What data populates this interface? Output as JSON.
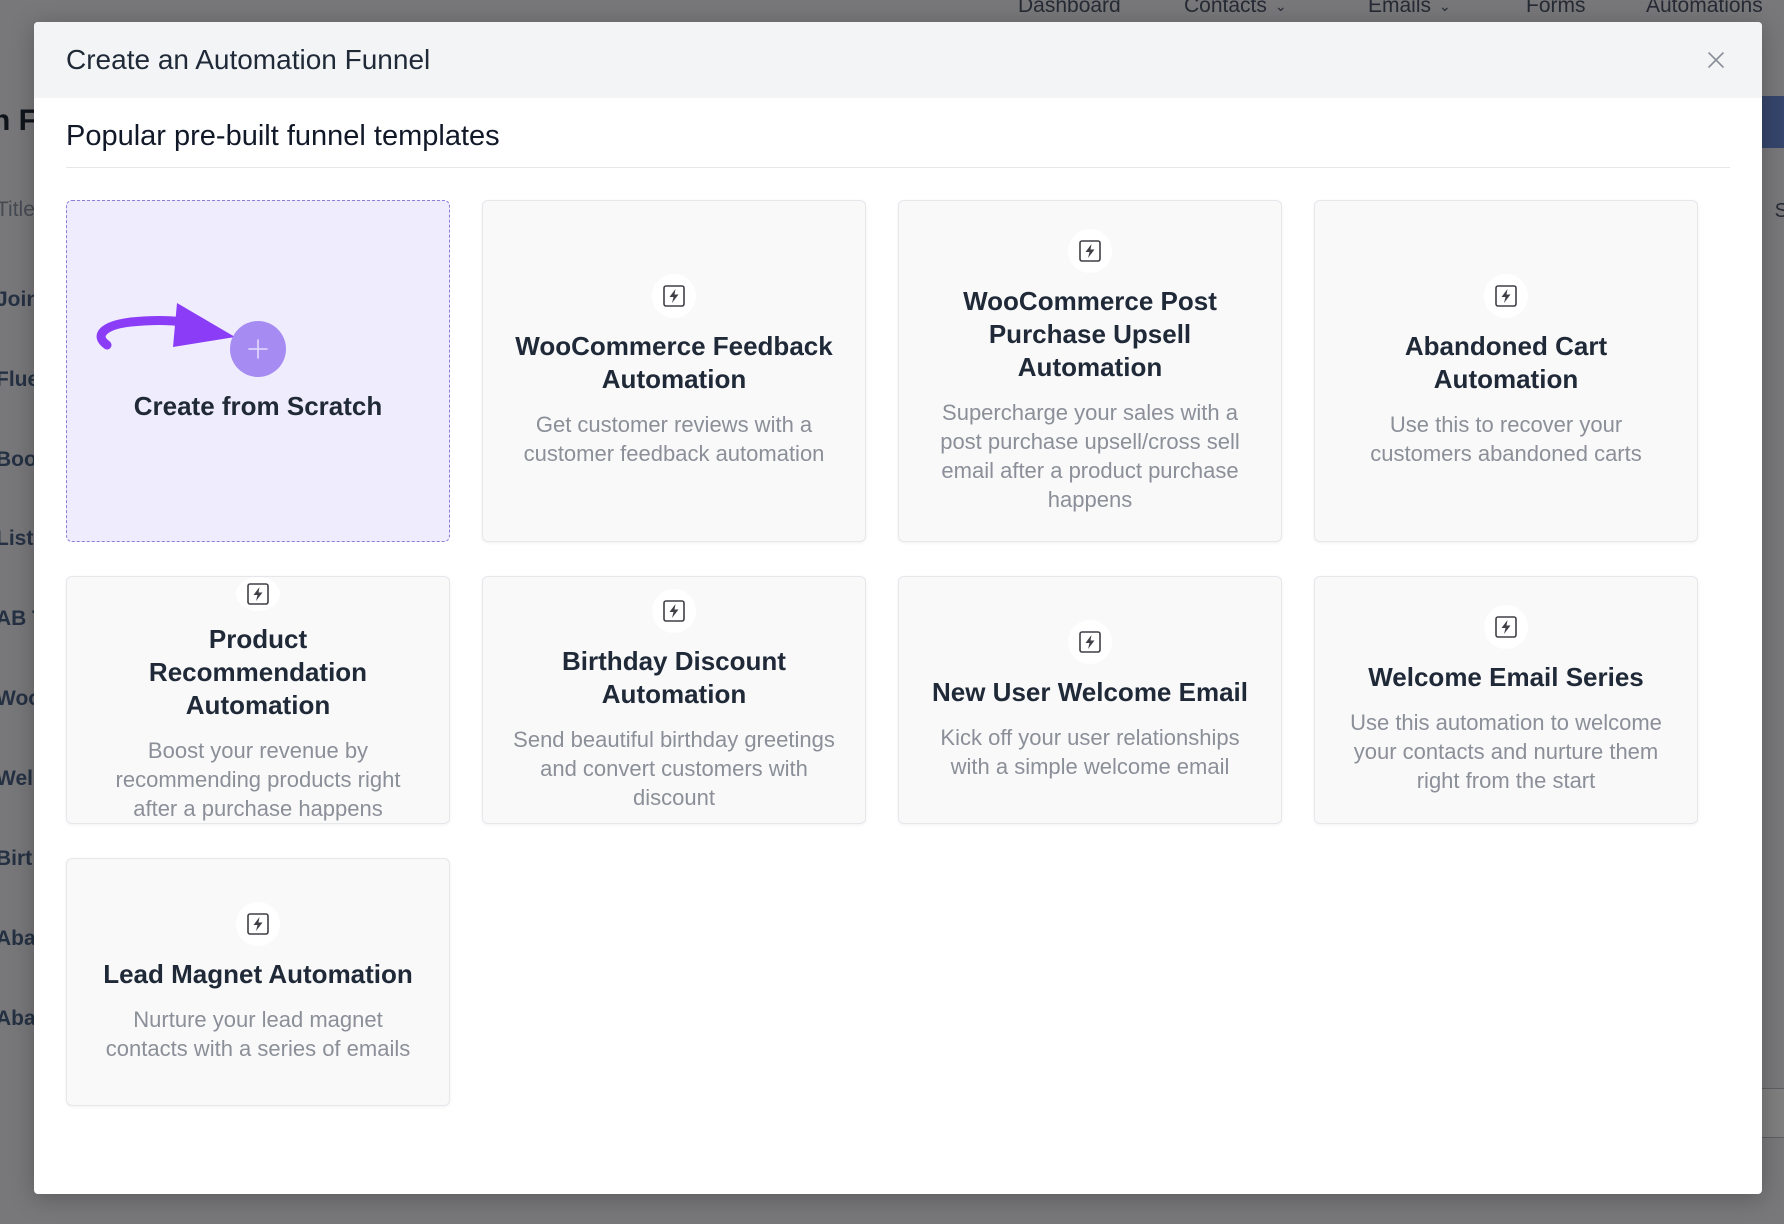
{
  "background": {
    "nav": [
      {
        "label": "Dashboard",
        "chevron": false
      },
      {
        "label": "Contacts",
        "chevron": true
      },
      {
        "label": "Emails",
        "chevron": true
      },
      {
        "label": "Forms",
        "chevron": false
      },
      {
        "label": "Automations",
        "chevron": false
      }
    ],
    "page_title": "n Fu",
    "sidebar": [
      "Title",
      "Join",
      "Flue",
      "Boo",
      "List",
      "AB T",
      "Woo",
      "Wel",
      "Birt",
      "Aba",
      "Aba"
    ],
    "right_text": "S"
  },
  "modal": {
    "title": "Create an Automation Funnel",
    "section_title": "Popular pre-built funnel templates",
    "scratch": {
      "label": "Create from Scratch",
      "arrow_color": "#8b3cf7",
      "plus_color": "#a68bf2"
    },
    "templates": [
      {
        "title": "WooCommerce Feedback Automation",
        "description": "Get customer reviews with a customer feedback automation",
        "icon": "bolt-icon"
      },
      {
        "title": "WooCommerce Post Purchase Upsell Automation",
        "description": "Supercharge your sales with a post purchase upsell/cross sell email after a product purchase happens",
        "icon": "bolt-icon"
      },
      {
        "title": "Abandoned Cart Automation",
        "description": "Use this to recover your customers abandoned carts",
        "icon": "bolt-icon"
      },
      {
        "title": "Product Recommendation Automation",
        "description": "Boost your revenue by recommending products right after a purchase happens",
        "icon": "bolt-icon"
      },
      {
        "title": "Birthday Discount Automation",
        "description": "Send beautiful birthday greetings and convert customers with discount",
        "icon": "bolt-icon"
      },
      {
        "title": "New User Welcome Email",
        "description": "Kick off your user relationships with a simple welcome email",
        "icon": "bolt-icon"
      },
      {
        "title": "Welcome Email Series",
        "description": "Use this automation to welcome your contacts and nurture them right from the start",
        "icon": "bolt-icon"
      },
      {
        "title": "Lead Magnet Automation",
        "description": "Nurture your lead magnet contacts with a series of emails",
        "icon": "bolt-icon"
      }
    ]
  }
}
